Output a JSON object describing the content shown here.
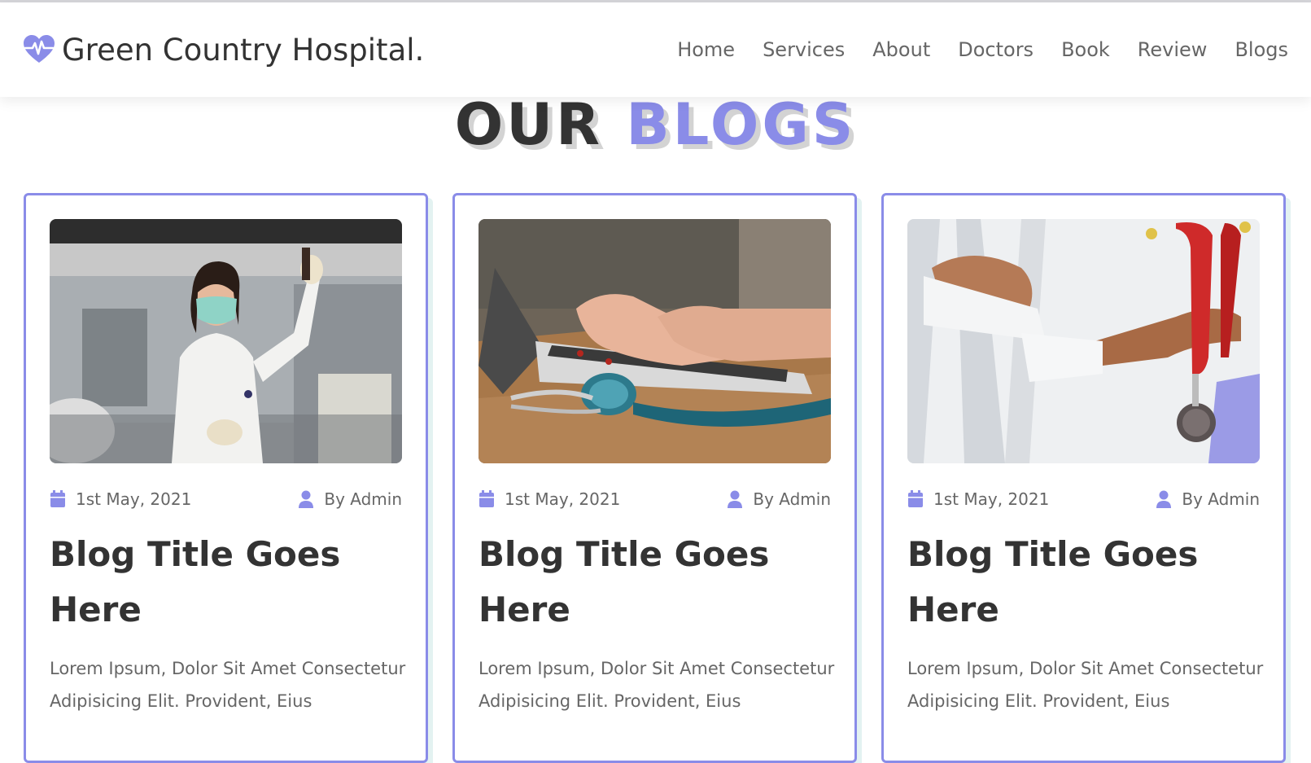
{
  "site": {
    "logo_icon": "heartbeat-icon",
    "brand_name": "Green Country Hospital."
  },
  "nav": {
    "items": [
      "Home",
      "Services",
      "About",
      "Doctors",
      "Book",
      "Review",
      "Blogs"
    ]
  },
  "section": {
    "heading_word1": "OUR",
    "heading_word2": "BLOGS"
  },
  "colors": {
    "accent": "#8a8ce8",
    "text_dark": "#333333",
    "text_muted": "#666666",
    "card_shadow": "#e3f2f1"
  },
  "blogs": [
    {
      "image": "doctor-with-mask-photo",
      "date_icon": "calendar-icon",
      "date": "1st May, 2021",
      "author_icon": "user-icon",
      "author": "By Admin",
      "title": "Blog Title Goes Here",
      "excerpt": "Lorem Ipsum, Dolor Sit Amet Consectetur Adipisicing Elit. Provident, Eius"
    },
    {
      "image": "laptop-stethoscope-photo",
      "date_icon": "calendar-icon",
      "date": "1st May, 2021",
      "author_icon": "user-icon",
      "author": "By Admin",
      "title": "Blog Title Goes Here",
      "excerpt": "Lorem Ipsum, Dolor Sit Amet Consectetur Adipisicing Elit. Provident, Eius"
    },
    {
      "image": "doctor-holding-stethoscope-photo",
      "date_icon": "calendar-icon",
      "date": "1st May, 2021",
      "author_icon": "user-icon",
      "author": "By Admin",
      "title": "Blog Title Goes Here",
      "excerpt": "Lorem Ipsum, Dolor Sit Amet Consectetur Adipisicing Elit. Provident, Eius"
    }
  ]
}
